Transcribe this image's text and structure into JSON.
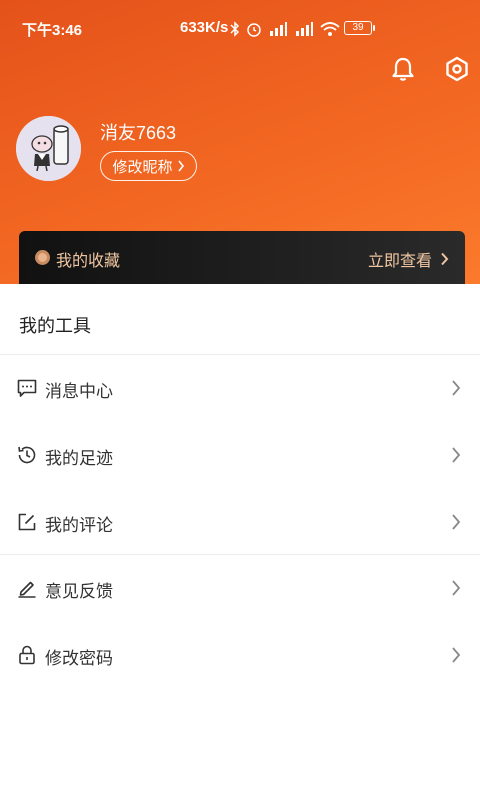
{
  "status_bar": {
    "time": "下午3:46",
    "network_speed": "633K/s",
    "battery": "39"
  },
  "header": {
    "username": "消友7663",
    "edit_nickname": "修改昵称"
  },
  "favorites": {
    "label": "我的收藏",
    "action": "立即查看"
  },
  "tools": {
    "title": "我的工具",
    "items": [
      {
        "label": "消息中心",
        "icon": "message-icon"
      },
      {
        "label": "我的足迹",
        "icon": "history-icon"
      },
      {
        "label": "我的评论",
        "icon": "edit-icon"
      },
      {
        "label": "意见反馈",
        "icon": "pen-icon"
      },
      {
        "label": "修改密码",
        "icon": "lock-icon"
      }
    ]
  },
  "colors": {
    "header_start": "#e4521a",
    "header_end": "#fb7a2c",
    "favorites_text": "#f0c6a2"
  }
}
